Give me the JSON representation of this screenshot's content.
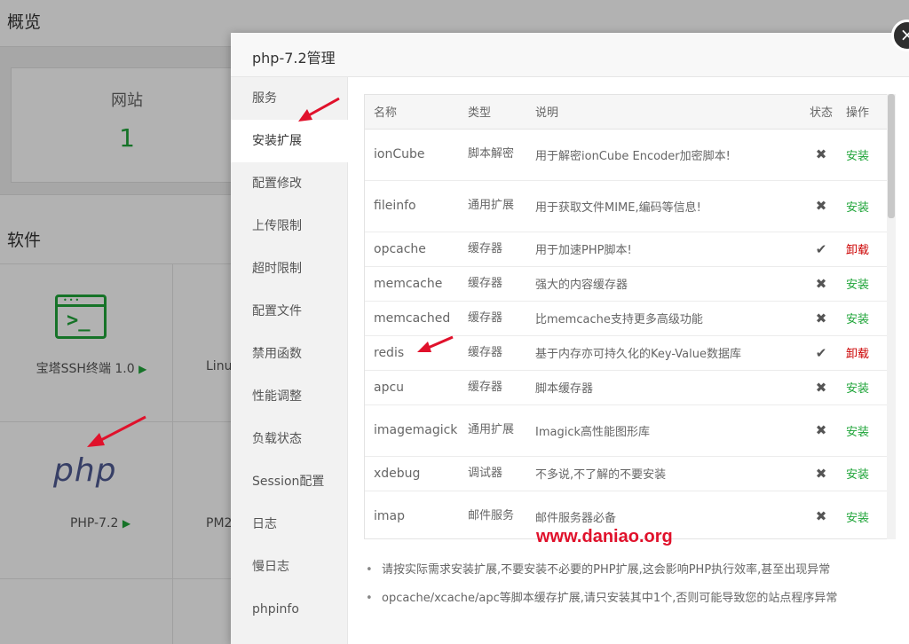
{
  "background": {
    "overview_title": "概览",
    "site_card_label": "网站",
    "site_card_value": "1",
    "software_title": "软件",
    "apps": [
      {
        "label": "宝塔SSH终端 1.0",
        "trigger": "▶"
      },
      {
        "label": "Linu",
        "trigger": ""
      },
      {
        "label": "PHP-7.2",
        "trigger": "▶"
      },
      {
        "label": "PM2",
        "trigger": ""
      }
    ],
    "php_logo_text": "php",
    "ssh_icon_text": ">_"
  },
  "modal": {
    "title": "php-7.2管理",
    "close_symbol": "×",
    "sidebar": [
      {
        "label": "服务"
      },
      {
        "label": "安装扩展",
        "active": true
      },
      {
        "label": "配置修改"
      },
      {
        "label": "上传限制"
      },
      {
        "label": "超时限制"
      },
      {
        "label": "配置文件"
      },
      {
        "label": "禁用函数"
      },
      {
        "label": "性能调整"
      },
      {
        "label": "负载状态"
      },
      {
        "label": "Session配置"
      },
      {
        "label": "日志"
      },
      {
        "label": "慢日志"
      },
      {
        "label": "phpinfo"
      }
    ],
    "table": {
      "headers": {
        "name": "名称",
        "type": "类型",
        "desc": "说明",
        "status": "状态",
        "op": "操作"
      },
      "rows": [
        {
          "name": "ionCube",
          "type": "脚本解密",
          "desc": "用于解密ionCube Encoder加密脚本!",
          "status": "✖",
          "op": "安装",
          "op_kind": "install"
        },
        {
          "name": "fileinfo",
          "type": "通用扩展",
          "desc": "用于获取文件MIME,编码等信息!",
          "status": "✖",
          "op": "安装",
          "op_kind": "install"
        },
        {
          "name": "opcache",
          "type": "缓存器",
          "desc": "用于加速PHP脚本!",
          "status": "✔",
          "op": "卸载",
          "op_kind": "uninstall"
        },
        {
          "name": "memcache",
          "type": "缓存器",
          "desc": "强大的内容缓存器",
          "status": "✖",
          "op": "安装",
          "op_kind": "install"
        },
        {
          "name": "memcached",
          "type": "缓存器",
          "desc": "比memcache支持更多高级功能",
          "status": "✖",
          "op": "安装",
          "op_kind": "install"
        },
        {
          "name": "redis",
          "type": "缓存器",
          "desc": "基于内存亦可持久化的Key-Value数据库",
          "status": "✔",
          "op": "卸载",
          "op_kind": "uninstall"
        },
        {
          "name": "apcu",
          "type": "缓存器",
          "desc": "脚本缓存器",
          "status": "✖",
          "op": "安装",
          "op_kind": "install"
        },
        {
          "name": "imagemagick",
          "type": "通用扩展",
          "desc": "Imagick高性能图形库",
          "status": "✖",
          "op": "安装",
          "op_kind": "install"
        },
        {
          "name": "xdebug",
          "type": "调试器",
          "desc": "不多说,不了解的不要安装",
          "status": "✖",
          "op": "安装",
          "op_kind": "install"
        },
        {
          "name": "imap",
          "type": "邮件服务",
          "desc": "邮件服务器必备",
          "status": "✖",
          "op": "安装",
          "op_kind": "install"
        }
      ]
    },
    "notes": [
      "请按实际需求安装扩展,不要安装不必要的PHP扩展,这会影响PHP执行效率,甚至出现异常",
      "opcache/xcache/apc等脚本缓存扩展,请只安装其中1个,否则可能导致您的站点程序异常"
    ]
  },
  "watermark": "www.daniao.org",
  "colors": {
    "accent_green": "#20a53a",
    "uninstall_red": "#cc0000",
    "annotation_red": "#e0112b"
  }
}
